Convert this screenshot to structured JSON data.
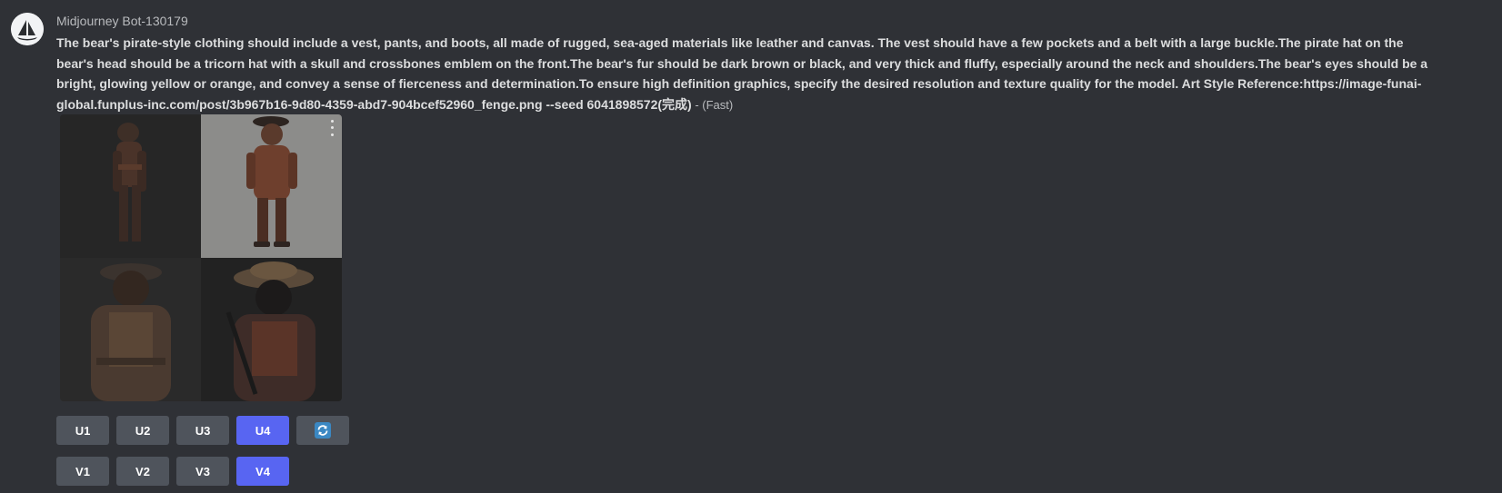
{
  "message": {
    "author": "Midjourney Bot-130179",
    "prompt": "The bear's pirate-style clothing should include a vest, pants, and boots, all made of rugged, sea-aged materials like leather and canvas. The vest should have a few pockets and a belt with a large buckle.The pirate hat on the bear's head should be a tricorn hat with a skull and crossbones emblem on the front.The bear's fur should be dark brown or black, and very thick and fluffy, especially around the neck and shoulders.The bear's eyes should be a bright, glowing yellow or orange, and convey a sense of fierceness and determination.To ensure high definition graphics, specify the desired resolution and texture quality for the model. Art Style Reference:https://image-funai-global.funplus-inc.com/post/3b967b16-9d80-4359-abd7-904bcef52960_fenge.png --seed 6041898572(完成)",
    "suffix": " - (Fast)"
  },
  "images": [
    {
      "name": "image-1"
    },
    {
      "name": "image-2"
    },
    {
      "name": "image-3"
    },
    {
      "name": "image-4"
    }
  ],
  "buttons": {
    "upscale": [
      "U1",
      "U2",
      "U3",
      "U4"
    ],
    "variation": [
      "V1",
      "V2",
      "V3",
      "V4"
    ],
    "reroll_icon": "refresh-icon",
    "active": [
      "U4",
      "V4"
    ]
  },
  "colors": {
    "background": "#2f3136",
    "button": "#4f545c",
    "active_button": "#5865f2",
    "reroll": "#3b88c3"
  }
}
